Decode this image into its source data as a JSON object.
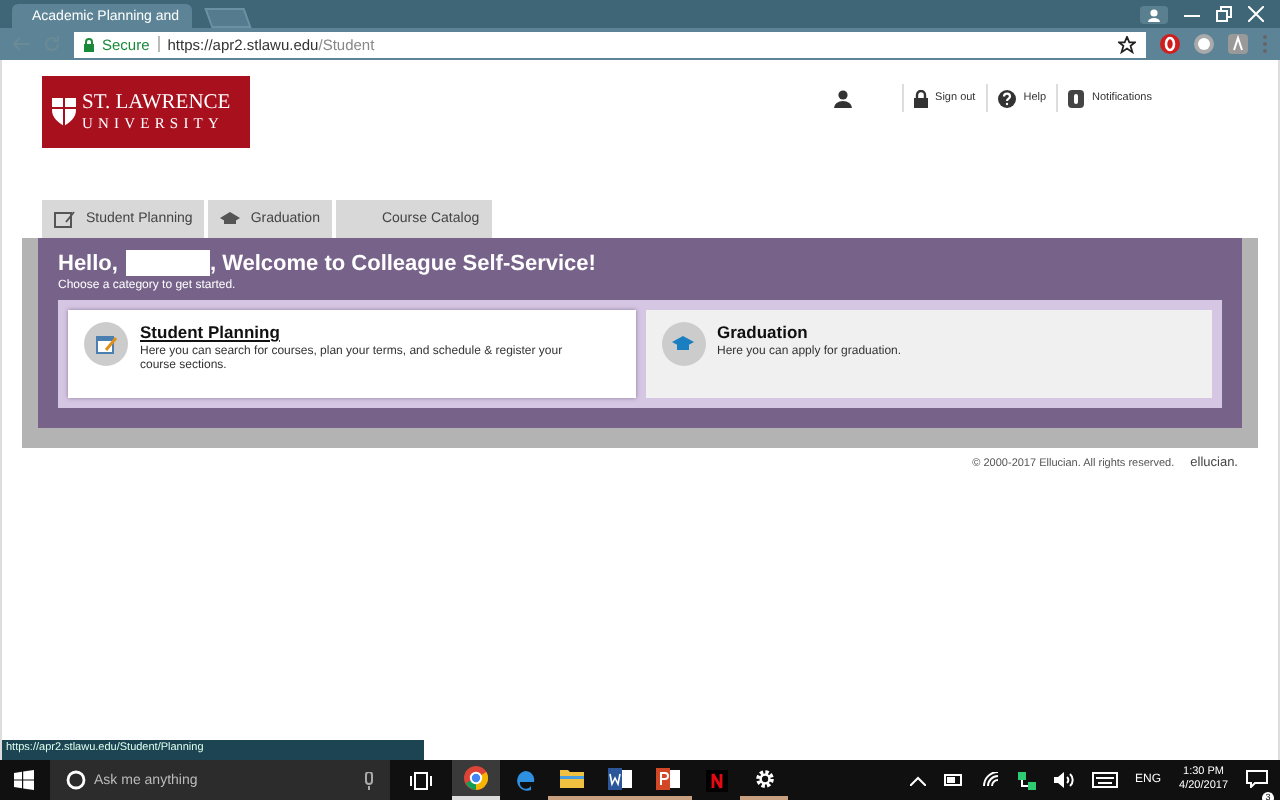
{
  "browser": {
    "tab_title": "Academic Planning and",
    "security": "Secure",
    "url_host": "https://apr2.stlawu.edu",
    "url_path": "/Student"
  },
  "header": {
    "logo": {
      "line1": "ST. LAWRENCE",
      "line2": "UNIVERSITY"
    },
    "links": [
      {
        "kind": "user"
      },
      {
        "kind": "lock",
        "label": "Sign out"
      },
      {
        "kind": "help",
        "label": "Help"
      },
      {
        "kind": "bell",
        "label": "Notifications"
      }
    ]
  },
  "tabs": [
    {
      "kind": "planning",
      "label": "Student Planning"
    },
    {
      "kind": "cap",
      "label": "Graduation"
    },
    {
      "kind": "none",
      "label": "Course Catalog"
    }
  ],
  "banner": {
    "greeting": "Hello,",
    "welcome": ", Welcome to Colleague Self-Service!",
    "subtitle": "Choose a category to get started."
  },
  "cards": [
    {
      "kind": "planning",
      "title": "Student Planning",
      "description": "Here you can search for courses, plan your terms, and schedule & register your course sections.",
      "hovered": true
    },
    {
      "kind": "cap",
      "title": "Graduation",
      "description": "Here you can apply for graduation.",
      "hovered": false
    }
  ],
  "footer": {
    "copyright": "© 2000-2017 Ellucian. All rights reserved.",
    "brand": "ellucian."
  },
  "status_url": "https://apr2.stlawu.edu/Student/Planning",
  "taskbar": {
    "search_placeholder": "Ask me anything",
    "apps": [
      {
        "kind": "chrome",
        "active": true,
        "open": true
      },
      {
        "kind": "edge",
        "active": false,
        "open": false
      },
      {
        "kind": "folder",
        "active": false,
        "open": true
      },
      {
        "kind": "word",
        "active": false,
        "open": true
      },
      {
        "kind": "powerpoint",
        "active": false,
        "open": true
      },
      {
        "kind": "netflix",
        "active": false,
        "open": false
      },
      {
        "kind": "gear",
        "active": false,
        "open": true
      }
    ],
    "language": "ENG",
    "time": "1:30 PM",
    "date": "4/20/2017",
    "notification_count": "3"
  }
}
